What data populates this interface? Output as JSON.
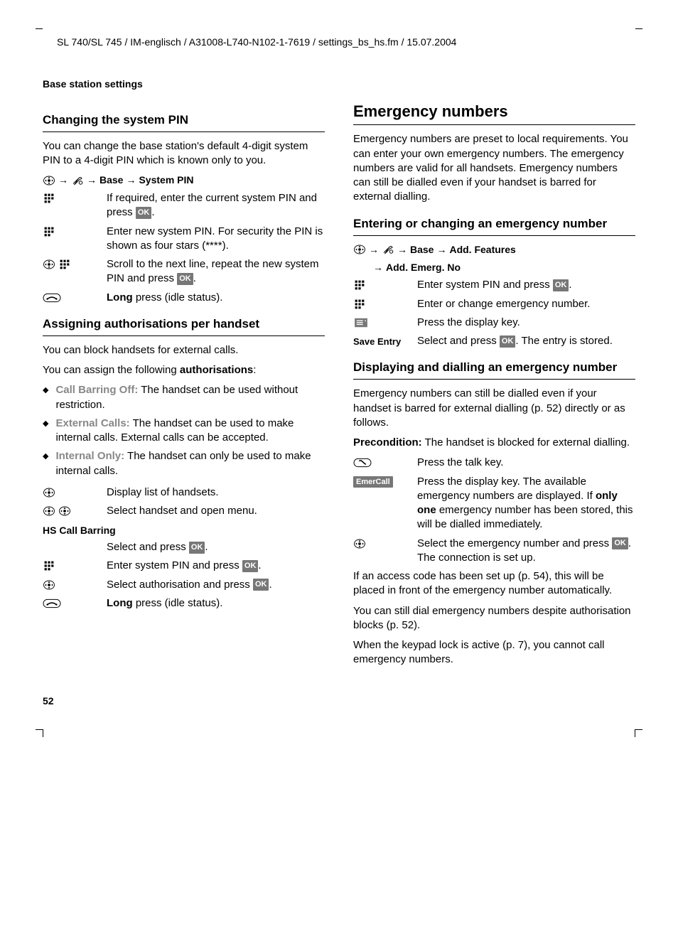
{
  "header_path": "SL 740/SL 745 / IM-englisch / A31008-L740-N102-1-7619 / settings_bs_hs.fm / 15.07.2004",
  "section_label": "Base station settings",
  "page_number": "52",
  "left": {
    "h2_1": "Changing the system PIN",
    "p1": "You can change the base station's default 4-digit system PIN to a 4-digit PIN which is known only to you.",
    "nav1_a": "Base",
    "nav1_b": "System PIN",
    "steps1": [
      {
        "text_a": "If required, enter the current system PIN and press ",
        "ok": true,
        "text_b": "."
      },
      {
        "text_a": "Enter new system PIN. For security the PIN is shown as four stars (****)."
      },
      {
        "text_a": "Scroll to the next line, repeat the new system PIN and press ",
        "ok": true,
        "text_b": "."
      },
      {
        "bold_a": "Long",
        "text_a": " press (idle status)."
      }
    ],
    "h2_2": "Assigning authorisations per handset",
    "p2": "You can block handsets for external calls.",
    "p3a": "You can assign the following ",
    "p3b": "authorisations",
    "p3c": ":",
    "bullets": [
      {
        "label": "Call Barring Off:",
        "text": " The handset can be used without restriction."
      },
      {
        "label": "External Calls:",
        "text": " The handset can be used to make internal calls. External calls can be accepted."
      },
      {
        "label": "Internal Only:",
        "text": " The handset can only be used to make internal calls."
      }
    ],
    "steps2": [
      {
        "text_a": "Display list of handsets."
      },
      {
        "text_a": "Select handset and open menu."
      }
    ],
    "sub_label": "HS Call Barring",
    "steps3": [
      {
        "text_a": "Select and press ",
        "ok": true,
        "text_b": "."
      },
      {
        "text_a": "Enter system PIN and press ",
        "ok": true,
        "text_b": "."
      },
      {
        "text_a": "Select authorisation and press ",
        "ok": true,
        "text_b": "."
      },
      {
        "bold_a": "Long",
        "text_a": " press (idle status)."
      }
    ]
  },
  "right": {
    "h1": "Emergency numbers",
    "p1": "Emergency numbers are preset to local requirements. You can enter your own emergency numbers. The emergency numbers are valid for all handsets. Emergency numbers can still be dialled even if your handset is barred for external dialling.",
    "h2_1": "Entering or changing an emergency number",
    "nav1_a": "Base",
    "nav1_b": "Add. Features",
    "nav1_c": "Add. Emerg. No",
    "steps1": [
      {
        "text_a": "Enter system PIN and press ",
        "ok": true,
        "text_b": "."
      },
      {
        "text_a": "Enter or change emergency number."
      },
      {
        "text_a": "Press the display key."
      },
      {
        "label": "Save Entry",
        "text_a": "Select and press ",
        "ok": true,
        "text_b": ". The entry is stored."
      }
    ],
    "h2_2": "Displaying and dialling an emergency number",
    "p2": "Emergency numbers can still be dialled even if your handset is barred for external dialling (p. 52) directly or as follows.",
    "p3a": "Precondition:",
    "p3b": " The handset is blocked for external dialling.",
    "steps2": [
      {
        "text_a": "Press the talk key."
      },
      {
        "label": "EmerCall",
        "text_a": "Press the display key. The available emergency numbers are displayed. If ",
        "bold_mid": "only one",
        "text_b": " emergency number has been stored, this will be dialled immediately."
      },
      {
        "text_a": "Select the emergency number and press ",
        "ok": true,
        "text_b": ". The connection is set up."
      }
    ],
    "p4": "If an access code has been set up (p. 54), this will be placed in front of the emergency number automatically.",
    "p5": "You can still dial emergency numbers despite authorisation blocks (p. 52).",
    "p6": "When the keypad lock is active (p. 7), you cannot call emergency numbers."
  }
}
